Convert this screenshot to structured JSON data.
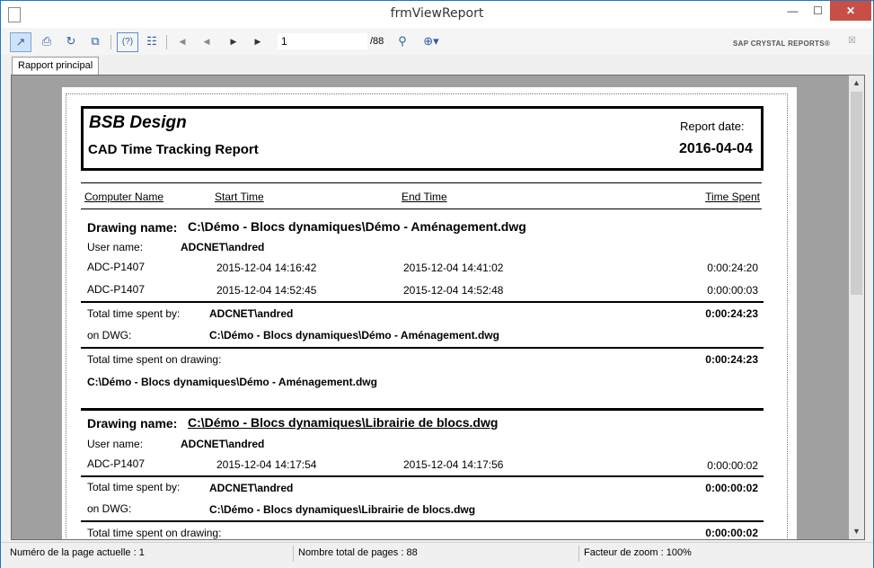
{
  "window": {
    "title": "frmViewReport"
  },
  "toolbar": {
    "current_page": "1",
    "total_pages": "/88",
    "brand": "SAP CRYSTAL REPORTS®"
  },
  "tabs": [
    {
      "label": "Rapport principal"
    }
  ],
  "report": {
    "company": "BSB Design",
    "title": "CAD Time Tracking Report",
    "report_date_label": "Report date:",
    "report_date": "2016-04-04",
    "columns": {
      "computer_name": "Computer Name",
      "start_time": "Start Time",
      "end_time": "End Time",
      "time_spent": "Time Spent"
    },
    "labels": {
      "drawing_name": "Drawing name:",
      "user_name": "User name:",
      "total_time_by": "Total time spent by:",
      "on_dwg": "on DWG:",
      "total_time_drawing": "Total time spent on drawing:"
    },
    "groups": [
      {
        "drawing": "C:\\Démo - Blocs dynamiques\\Démo - Aménagement.dwg",
        "user": "ADCNET\\andred",
        "rows": [
          {
            "computer": "ADC-P1407",
            "start": "2015-12-04  14:16:42",
            "end": "2015-12-04  14:41:02",
            "spent": "0:00:24:20"
          },
          {
            "computer": "ADC-P1407",
            "start": "2015-12-04  14:52:45",
            "end": "2015-12-04  14:52:48",
            "spent": "0:00:00:03"
          }
        ],
        "user_total": "0:00:24:23",
        "drawing_total": "0:00:24:23"
      },
      {
        "drawing": "C:\\Démo - Blocs dynamiques\\Librairie de blocs.dwg",
        "user": "ADCNET\\andred",
        "rows": [
          {
            "computer": "ADC-P1407",
            "start": "2015-12-04  14:17:54",
            "end": "2015-12-04  14:17:56",
            "spent": "0:00:00:02"
          }
        ],
        "user_total": "0:00:00:02",
        "drawing_total": "0:00:00:02"
      }
    ]
  },
  "status": {
    "current_page": "Numéro de la page actuelle : 1",
    "total_pages": "Nombre total de pages : 88",
    "zoom": "Facteur de zoom : 100%"
  }
}
